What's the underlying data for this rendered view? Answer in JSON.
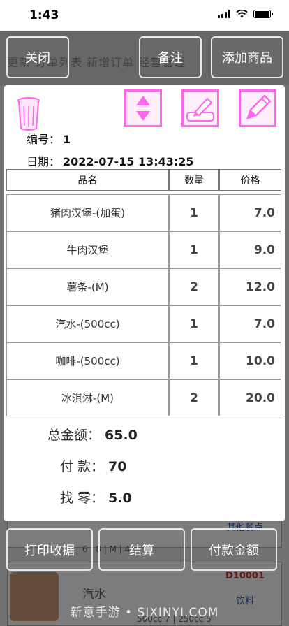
{
  "status_bar": {
    "time": "1:43"
  },
  "background": {
    "tabs_text": "更新  订单列表  新增订单  经营管理",
    "item_name": "汽水",
    "item_code": "D10001",
    "item_category": "饮料",
    "item_category_above": "其他餐点",
    "item_spec": "500cc 7 | 250cc 5",
    "item_mid": "6 | 8 | M | 4"
  },
  "toolbar": {
    "close_label": "关闭",
    "note_label": "备注",
    "add_item_label": "添加商品"
  },
  "order": {
    "number_label": "编号：",
    "number": "1",
    "date_label": "日期：",
    "date": "2022-07-15 13:43:25",
    "columns": {
      "name": "品名",
      "qty": "数量",
      "price": "价格"
    },
    "items": [
      {
        "name": "猪肉汉堡-(加蛋)",
        "qty": "1",
        "price": "7.0"
      },
      {
        "name": "牛肉汉堡",
        "qty": "1",
        "price": "9.0"
      },
      {
        "name": "薯条-(M)",
        "qty": "2",
        "price": "12.0"
      },
      {
        "name": "汽水-(500cc)",
        "qty": "1",
        "price": "7.0"
      },
      {
        "name": "咖啡-(500cc)",
        "qty": "1",
        "price": "10.0"
      },
      {
        "name": "冰淇淋-(M)",
        "qty": "2",
        "price": "20.0"
      }
    ],
    "total_label": "总金额：",
    "total": "65.0",
    "paid_label": "付 款：",
    "paid": "70",
    "change_label": "找 零：",
    "change": "5.0"
  },
  "actions": {
    "print_label": "打印收据",
    "checkout_label": "结算",
    "payment_label": "付款金额"
  },
  "watermark": "新意手游 • SJXINYI.COM",
  "colors": {
    "accent_pink": "#ff66ee",
    "dialog_bg": "#ffffff"
  }
}
